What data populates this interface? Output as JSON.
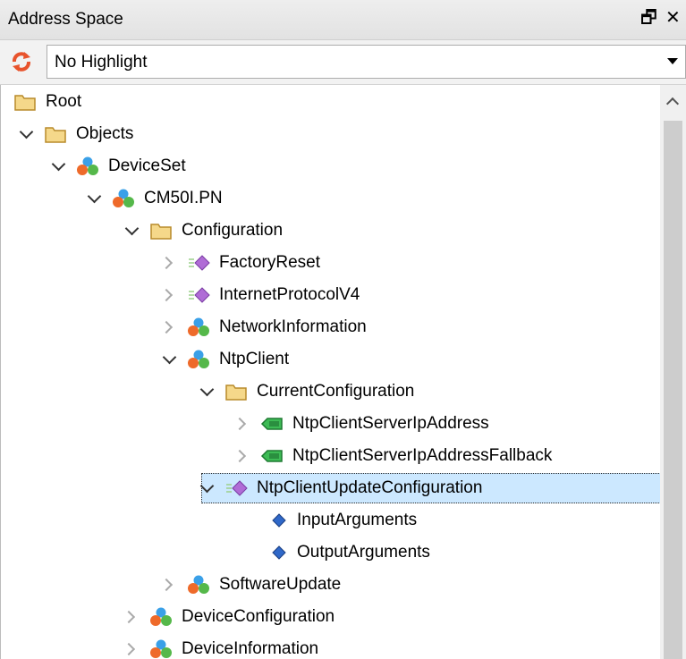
{
  "header": {
    "title": "Address Space",
    "float_glyph": "🗗",
    "close_glyph": "✕"
  },
  "toolbar": {
    "filter_value": "No Highlight"
  },
  "tree": [
    {
      "label": "Root",
      "icon": "folder-icon",
      "expander": "none"
    },
    {
      "label": "Objects",
      "icon": "folder-icon",
      "expander": "expanded"
    },
    {
      "label": "DeviceSet",
      "icon": "object-icon",
      "expander": "expanded"
    },
    {
      "label": "CM50I.PN",
      "icon": "object-icon",
      "expander": "expanded"
    },
    {
      "label": "Configuration",
      "icon": "folder-icon",
      "expander": "expanded"
    },
    {
      "label": "FactoryReset",
      "icon": "method-icon",
      "expander": "collapsed"
    },
    {
      "label": "InternetProtocolV4",
      "icon": "method-icon",
      "expander": "collapsed"
    },
    {
      "label": "NetworkInformation",
      "icon": "object-icon",
      "expander": "collapsed"
    },
    {
      "label": "NtpClient",
      "icon": "object-icon",
      "expander": "expanded"
    },
    {
      "label": "CurrentConfiguration",
      "icon": "folder-icon",
      "expander": "expanded"
    },
    {
      "label": "NtpClientServerIpAddress",
      "icon": "variable-icon",
      "expander": "collapsed"
    },
    {
      "label": "NtpClientServerIpAddressFallback",
      "icon": "variable-icon",
      "expander": "collapsed"
    },
    {
      "label": "NtpClientUpdateConfiguration",
      "icon": "method-icon",
      "expander": "expanded",
      "selected": true
    },
    {
      "label": "InputArguments",
      "icon": "property-icon",
      "expander": "none"
    },
    {
      "label": "OutputArguments",
      "icon": "property-icon",
      "expander": "none"
    },
    {
      "label": "SoftwareUpdate",
      "icon": "object-icon",
      "expander": "collapsed"
    },
    {
      "label": "DeviceConfiguration",
      "icon": "object-icon",
      "expander": "collapsed"
    },
    {
      "label": "DeviceInformation",
      "icon": "object-icon",
      "expander": "collapsed"
    }
  ],
  "colors": {
    "selection": "#cce8ff",
    "folder": "#f5d88a",
    "method": "#b06cd6",
    "variable": "#3dbb55",
    "property": "#2f68c8"
  }
}
